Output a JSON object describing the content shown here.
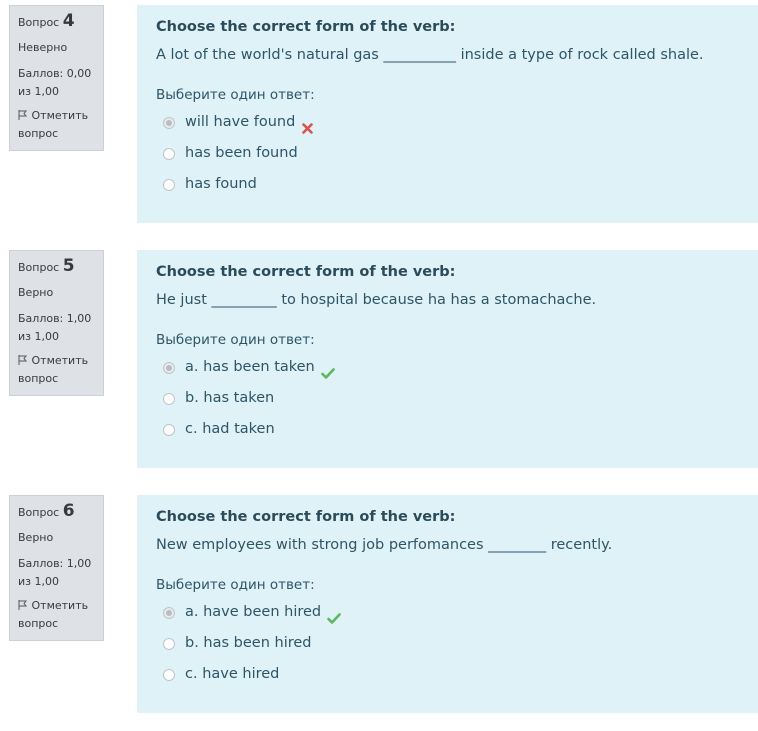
{
  "questions": [
    {
      "label": "Вопрос",
      "number": "4",
      "state": "Неверно",
      "grade": "Баллов: 0,00 из 1,00",
      "flag_label": "Отметить вопрос",
      "title": "Choose the correct form of the verb:",
      "text": "A lot of the world's natural gas __________ inside a type of rock called shale.",
      "prompt": "Выберите один ответ:",
      "options": [
        {
          "label": "will have found",
          "checked": true,
          "mark": "incorrect-icon"
        },
        {
          "label": "has been found",
          "checked": false
        },
        {
          "label": "has found",
          "checked": false
        }
      ]
    },
    {
      "label": "Вопрос",
      "number": "5",
      "state": "Верно",
      "grade": "Баллов: 1,00 из 1,00",
      "flag_label": "Отметить вопрос",
      "title": "Choose the correct form of the verb:",
      "text": "He just _________ to hospital because ha has a stomachache.",
      "prompt": "Выберите один ответ:",
      "options": [
        {
          "label": "a. has been taken",
          "checked": true,
          "mark": "correct-icon"
        },
        {
          "label": "b. has taken",
          "checked": false
        },
        {
          "label": "c. had taken",
          "checked": false
        }
      ]
    },
    {
      "label": "Вопрос",
      "number": "6",
      "state": "Верно",
      "grade": "Баллов: 1,00 из 1,00",
      "flag_label": "Отметить вопрос",
      "title": "Choose the correct form of the verb:",
      "text": "New employees with strong job perfomances ________ recently.",
      "prompt": "Выберите один ответ:",
      "options": [
        {
          "label": "a. have been hired",
          "checked": true,
          "mark": "correct-icon"
        },
        {
          "label": "b. has been hired",
          "checked": false
        },
        {
          "label": "c. have hired",
          "checked": false
        }
      ]
    }
  ],
  "colors": {
    "info_bg": "#dee2e6",
    "content_bg": "#def2f8",
    "correct": "#5cb85c",
    "incorrect": "#d9534f"
  }
}
